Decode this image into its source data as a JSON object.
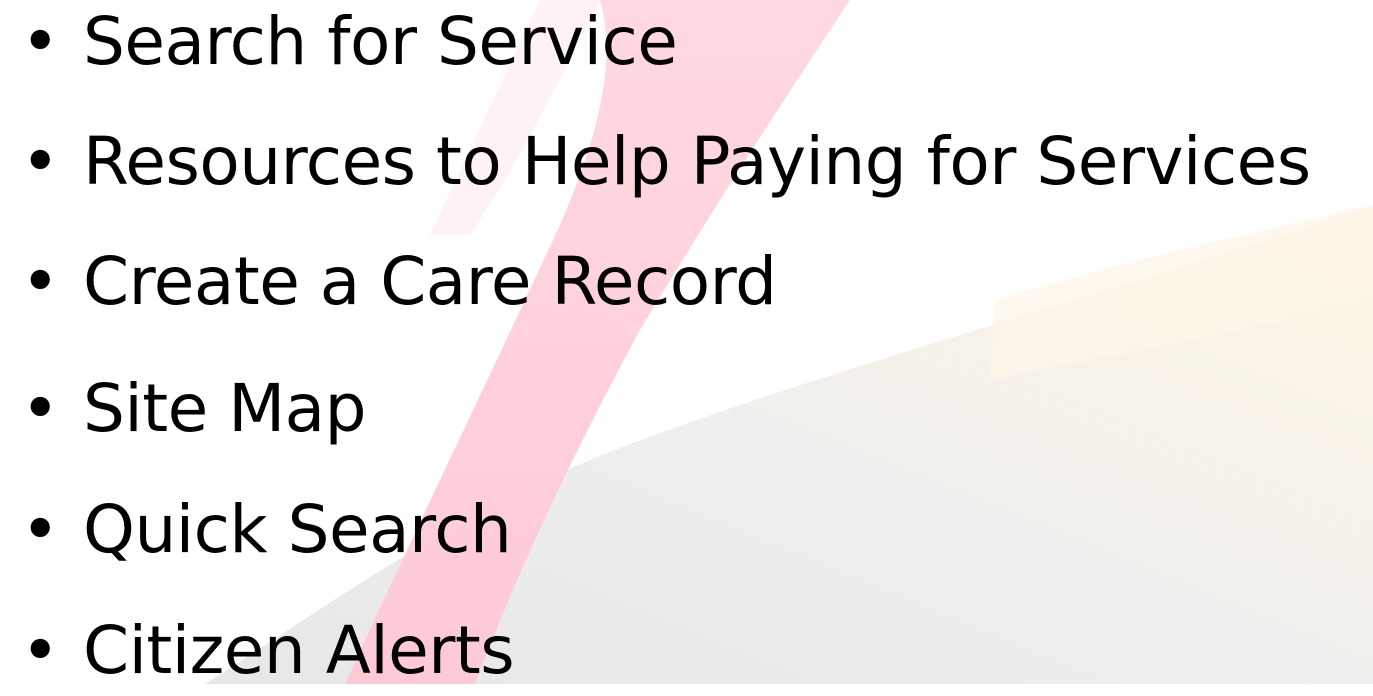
{
  "slide": {
    "bullets": [
      "Search for Service",
      "Resources to Help Paying for Services",
      "Create a Care Record",
      "Site Map",
      "Quick Search",
      "Citizen Alerts"
    ]
  },
  "colors": {
    "text": "#000000",
    "ribbon_pink": "#ffc9d6",
    "ribbon_grey": "#e3e3e3",
    "ribbon_yellow": "#fff4e3"
  },
  "icons": {
    "bullet": "bullet-dot"
  }
}
